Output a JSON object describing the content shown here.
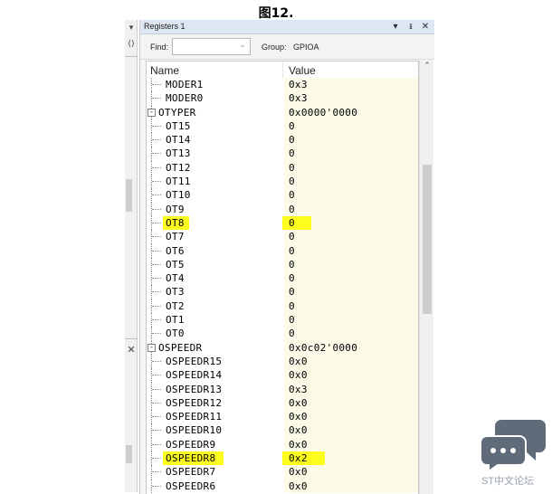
{
  "figure_caption": "图12.",
  "left_strip": {
    "glyphs": [
      "▾",
      "()",
      "✕"
    ]
  },
  "window": {
    "title": "Registers 1",
    "buttons": {
      "menu": "▾",
      "pin": "ᵻ",
      "close": "✕"
    },
    "toolbar": {
      "find_label": "Find:",
      "find_value": "",
      "group_label": "Group:",
      "group_value": "GPIOA"
    },
    "columns": {
      "name": "Name",
      "value": "Value"
    },
    "rows": [
      {
        "name": "MODER1",
        "value": "0x3",
        "level": 1,
        "highlight": false
      },
      {
        "name": "MODER0",
        "value": "0x3",
        "level": 1,
        "highlight": false
      },
      {
        "name": "OTYPER",
        "value": "0x0000'0000",
        "level": 0,
        "expander": "-",
        "highlight": false
      },
      {
        "name": "OT15",
        "value": "0",
        "level": 1,
        "highlight": false
      },
      {
        "name": "OT14",
        "value": "0",
        "level": 1,
        "highlight": false
      },
      {
        "name": "OT13",
        "value": "0",
        "level": 1,
        "highlight": false
      },
      {
        "name": "OT12",
        "value": "0",
        "level": 1,
        "highlight": false
      },
      {
        "name": "OT11",
        "value": "0",
        "level": 1,
        "highlight": false
      },
      {
        "name": "OT10",
        "value": "0",
        "level": 1,
        "highlight": false
      },
      {
        "name": "OT9",
        "value": "0",
        "level": 1,
        "highlight": false
      },
      {
        "name": "OT8",
        "value": "0",
        "level": 1,
        "highlight": true
      },
      {
        "name": "OT7",
        "value": "0",
        "level": 1,
        "highlight": false
      },
      {
        "name": "OT6",
        "value": "0",
        "level": 1,
        "highlight": false
      },
      {
        "name": "OT5",
        "value": "0",
        "level": 1,
        "highlight": false
      },
      {
        "name": "OT4",
        "value": "0",
        "level": 1,
        "highlight": false
      },
      {
        "name": "OT3",
        "value": "0",
        "level": 1,
        "highlight": false
      },
      {
        "name": "OT2",
        "value": "0",
        "level": 1,
        "highlight": false
      },
      {
        "name": "OT1",
        "value": "0",
        "level": 1,
        "highlight": false
      },
      {
        "name": "OT0",
        "value": "0",
        "level": 1,
        "highlight": false
      },
      {
        "name": "OSPEEDR",
        "value": "0x0c02'0000",
        "level": 0,
        "expander": "-",
        "highlight": false
      },
      {
        "name": "OSPEEDR15",
        "value": "0x0",
        "level": 1,
        "highlight": false
      },
      {
        "name": "OSPEEDR14",
        "value": "0x0",
        "level": 1,
        "highlight": false
      },
      {
        "name": "OSPEEDR13",
        "value": "0x3",
        "level": 1,
        "highlight": false
      },
      {
        "name": "OSPEEDR12",
        "value": "0x0",
        "level": 1,
        "highlight": false
      },
      {
        "name": "OSPEEDR11",
        "value": "0x0",
        "level": 1,
        "highlight": false
      },
      {
        "name": "OSPEEDR10",
        "value": "0x0",
        "level": 1,
        "highlight": false
      },
      {
        "name": "OSPEEDR9",
        "value": "0x0",
        "level": 1,
        "highlight": false
      },
      {
        "name": "OSPEEDR8",
        "value": "0x2",
        "level": 1,
        "highlight": true
      },
      {
        "name": "OSPEEDR7",
        "value": "0x0",
        "level": 1,
        "highlight": false
      },
      {
        "name": "OSPEEDR6",
        "value": "0x0",
        "level": 1,
        "highlight": false
      }
    ]
  },
  "watermark": {
    "text": "ST中文论坛"
  },
  "colors": {
    "highlight": "#fdfd1e",
    "value_column_bg": "#fbfbe8",
    "titlebar_bg": "#dde6f2",
    "watermark": "#5f6b78"
  },
  "icons": {
    "watermark_logo": "chat-bubbles-icon",
    "scroll_up": "chevron-up-icon"
  }
}
